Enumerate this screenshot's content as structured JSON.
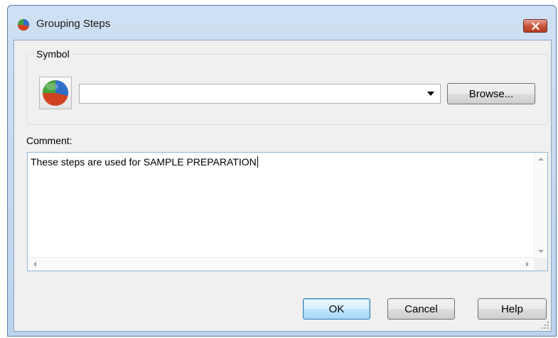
{
  "window": {
    "title": "Grouping Steps",
    "icon": "pie-chart-icon",
    "close_icon": "close-x-icon"
  },
  "symbol": {
    "group_label": "Symbol",
    "preview_icon": "pie-chart-icon",
    "selected_value": "",
    "browse_label": "Browse..."
  },
  "comment": {
    "label": "Comment:",
    "text": "These steps are used for SAMPLE PREPARATION"
  },
  "buttons": {
    "ok": "OK",
    "cancel": "Cancel",
    "help": "Help"
  },
  "colors": {
    "pie_blue": "#2d6fc9",
    "pie_green": "#43a23b",
    "pie_red": "#d0421f",
    "close_red": "#c8553d"
  }
}
